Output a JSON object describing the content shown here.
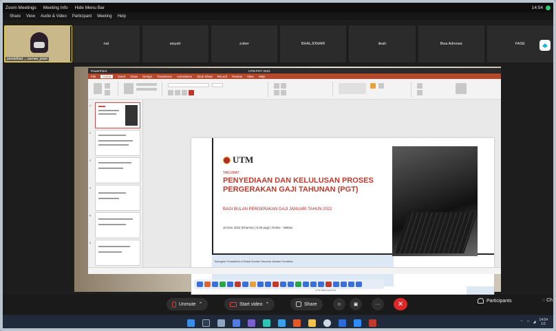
{
  "zoom": {
    "app_title": "Zoom Meetings",
    "meeting_info": "Meeting Info",
    "hide_menu_bar": "Hide Menu Bar",
    "time": "14:54",
    "menu": [
      "Share",
      "View",
      "Audio & Video",
      "Participant",
      "Meeting",
      "Help"
    ],
    "self_label": "pembi#lad ... surnee_jeanl ",
    "participants": [
      "nat",
      "aisyah",
      "zuber",
      "BHALJONAIR",
      "ileah",
      "Bwa Adnowa",
      "FASE"
    ],
    "controls": {
      "unmute": "Unmute",
      "start_video": "Start video",
      "share": "Share",
      "participants": "Participants",
      "chat": "Ch"
    }
  },
  "powerpoint": {
    "window_title": "PowerPoint",
    "doc_title": "UTM PGT 2022",
    "tabs": [
      "File",
      "Home",
      "Insert",
      "Draw",
      "Design",
      "Transitions",
      "Animations",
      "Slide Show",
      "Record",
      "Review",
      "View",
      "Help"
    ],
    "active_tab": "Home",
    "slide": {
      "logo": "UTM",
      "kicker": "TAKLIMAT",
      "title": "PENYEDIAAN DAN KELULUSAN PROSES PERGERAKAN GAJI TAHUNAN (PGT)",
      "subtitle": "BAGI BULAN PERGERAKAN GAJI JANUARI TAHUN 2022",
      "date": "10 Nov 2022 (Khamis) | 9.30 pagi | Online - Webex",
      "footer": "Bahagian Pentadbiran & Bakat Sumber Manusia Jabatan Pendaftar",
      "bottom": "UTM INNOVATIVE"
    }
  },
  "colors": {
    "zoom_end": "#e02828",
    "utm_red": "#c0392b",
    "ppt_accent": "#b7472a",
    "taskbar": "#1f2a3a"
  },
  "taskbar": {
    "tray_time": "14:54",
    "tray_date": "1/1"
  }
}
